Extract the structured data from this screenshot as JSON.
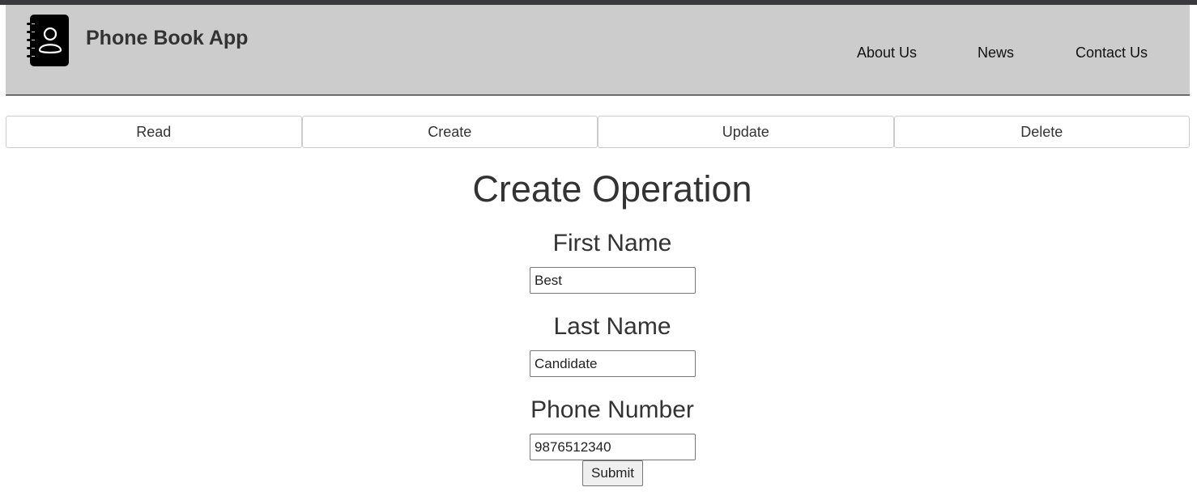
{
  "header": {
    "app_title": "Phone Book App",
    "logo_icon": "phone-book-icon",
    "nav": [
      {
        "label": "About Us"
      },
      {
        "label": "News"
      },
      {
        "label": "Contact Us"
      }
    ],
    "background": "#cccccc"
  },
  "tabs": [
    {
      "label": "Read"
    },
    {
      "label": "Create"
    },
    {
      "label": "Update"
    },
    {
      "label": "Delete"
    }
  ],
  "main": {
    "title": "Create Operation",
    "fields": [
      {
        "label": "First Name",
        "value": "Best"
      },
      {
        "label": "Last Name",
        "value": "Candidate"
      },
      {
        "label": "Phone Number",
        "value": "9876512340"
      }
    ],
    "submit_label": "Submit"
  }
}
